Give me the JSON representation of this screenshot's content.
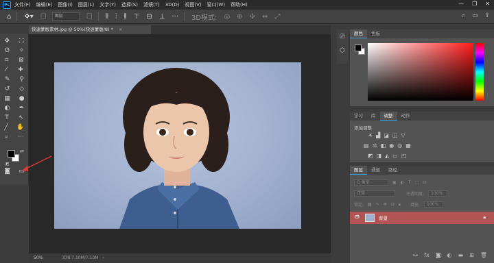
{
  "app": {
    "logo": "Ps"
  },
  "menu": [
    "文件(F)",
    "编辑(E)",
    "图像(I)",
    "图层(L)",
    "文字(Y)",
    "选择(S)",
    "滤镜(T)",
    "3D(D)",
    "视图(V)",
    "窗口(W)",
    "帮助(H)"
  ],
  "window_controls": {
    "minimize": "—",
    "restore": "❐",
    "close": "✕"
  },
  "options_bar": {
    "mode_select": "图层"
  },
  "document": {
    "tab_title": "快速蒙版素材.jpg @ 50%(快速蒙版/8) *",
    "close": "×",
    "zoom": "50%",
    "doc_info": "文档:7.10M/7.10M"
  },
  "panels": {
    "color": {
      "tabs": [
        "颜色",
        "色板"
      ],
      "active": 0
    },
    "adjustments": {
      "tabs": [
        "学习",
        "库",
        "调整",
        "动作"
      ],
      "active": 2,
      "title": "添加调整"
    },
    "layers": {
      "tabs": [
        "图层",
        "通道",
        "路径"
      ],
      "active": 0,
      "kind": "Q 类型",
      "blend": "正常",
      "opacity_label": "不透明度:",
      "opacity": "100%",
      "lock_label": "锁定:",
      "fill_label": "填充:",
      "fill": "100%",
      "layer_name": "背景"
    }
  },
  "colors": {
    "foreground": "#000000",
    "background": "#ffffff",
    "accent": "#31a8ff",
    "selected_layer": "#b25454",
    "annotation_arrow": "#e03a3a"
  }
}
